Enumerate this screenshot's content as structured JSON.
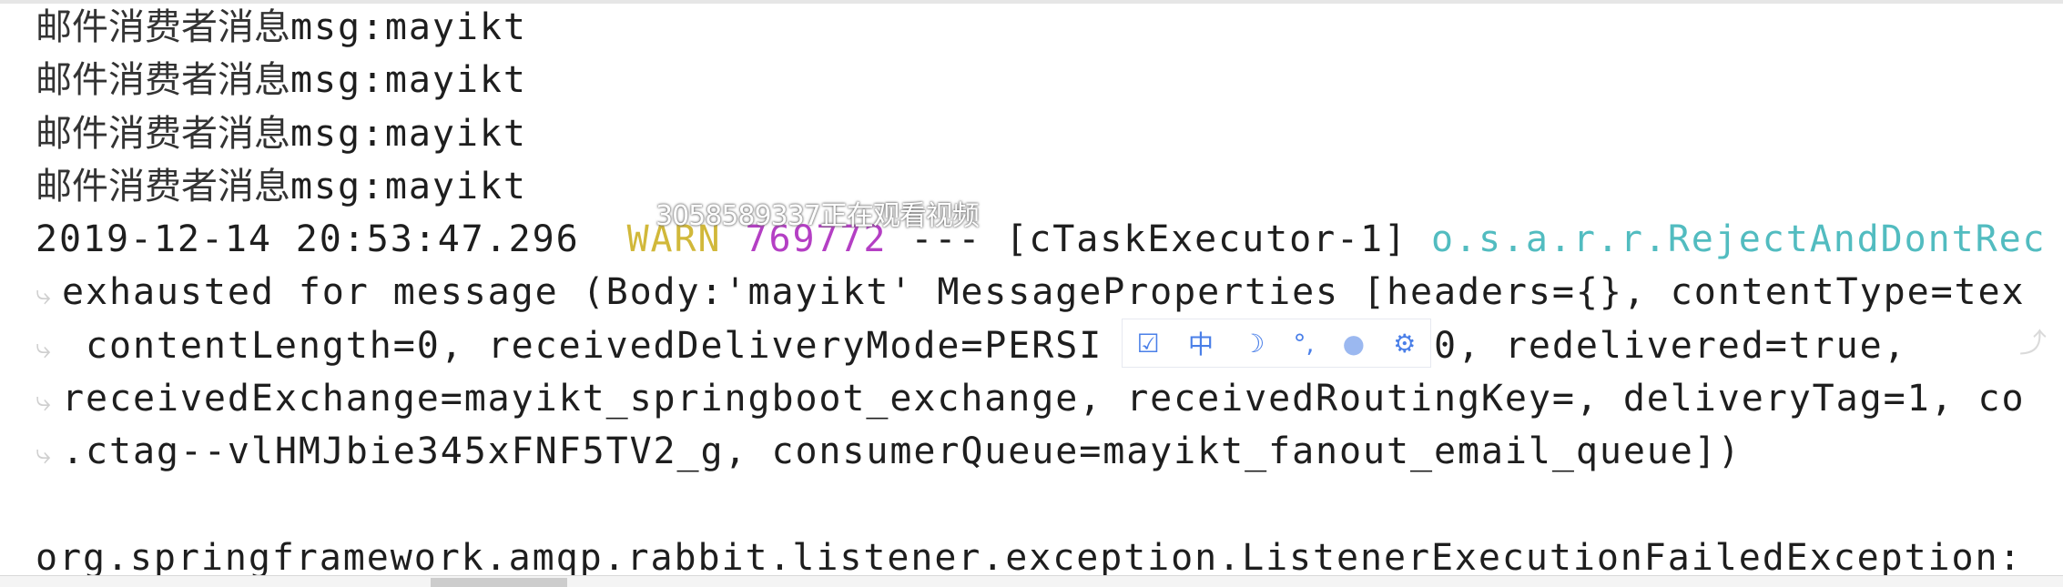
{
  "console": {
    "consumer_lines": [
      {
        "prefix": "邮件消费者消息",
        "text": "msg:mayikt"
      },
      {
        "prefix": "邮件消费者消息",
        "text": "msg:mayikt"
      },
      {
        "prefix": "邮件消费者消息",
        "text": "msg:mayikt"
      },
      {
        "prefix": "邮件消费者消息",
        "text": "msg:mayikt"
      }
    ],
    "log": {
      "timestamp": "2019-12-14 20:53:47.296",
      "level": "WARN",
      "pid": "769772",
      "separator": "---",
      "thread": "[cTaskExecutor-1]",
      "logger": "o.s.a.r.r.RejectAndDontRec"
    },
    "wrapped_lines": [
      "exhausted for message (Body:'mayikt' MessageProperties [headers={}, contentType=tex",
      " contentLength=0, receivedDeliveryMode=PERSI           ty=0, redelivered=true,",
      "receivedExchange=mayikt_springboot_exchange, receivedRoutingKey=, deliveryTag=1, co",
      ".ctag--vlHMJbie345xFNF5TV2_g, consumerQueue=mayikt_fanout_email_queue])"
    ],
    "exception_line": "org.springframework.amqp.rabbit.listener.exception.ListenerExecutionFailedException:"
  },
  "overlay": {
    "watermark": "3058589337正在观看视频",
    "ime_toolbar": {
      "items": [
        {
          "icon": "checkbox-pen-icon",
          "glyph": "☑"
        },
        {
          "icon": "chinese-mode-icon",
          "glyph": "中"
        },
        {
          "icon": "moon-icon",
          "glyph": "☽"
        },
        {
          "icon": "punctuation-icon",
          "glyph": "°,"
        },
        {
          "icon": "user-icon",
          "glyph": "👤"
        },
        {
          "icon": "gear-icon",
          "glyph": "⚙"
        }
      ]
    }
  },
  "colors": {
    "warn": "#d1b83a",
    "pid": "#b43fc4",
    "logger": "#52bcc0",
    "ime_accent": "#4a7fe8"
  }
}
